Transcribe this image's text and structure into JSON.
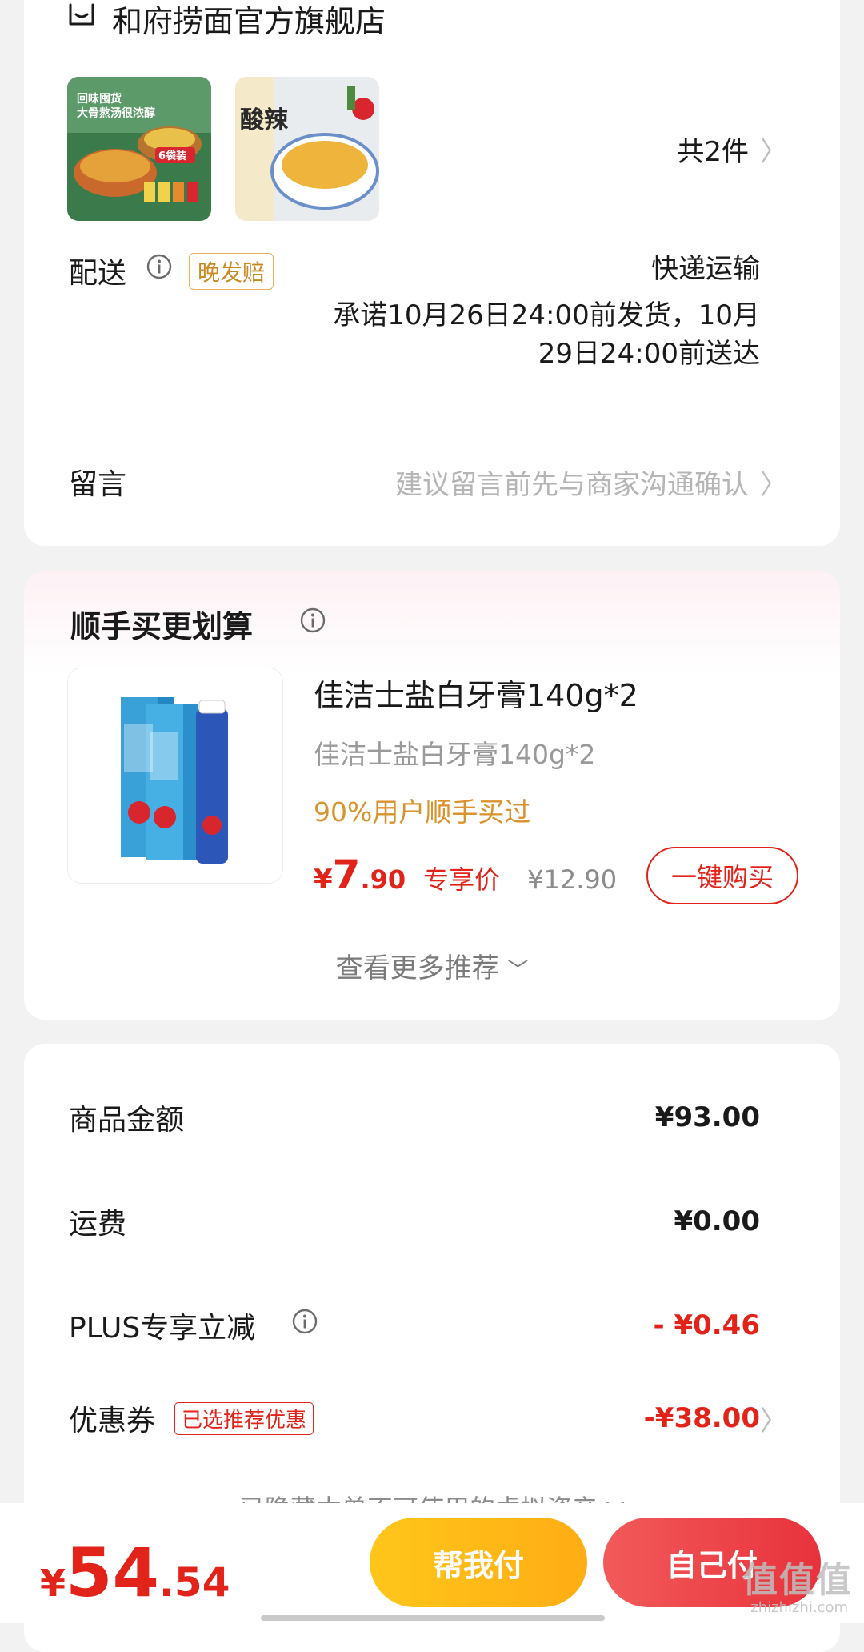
{
  "store": {
    "name": "和府捞面官方旗舰店",
    "thumb1_text_line1": "回味囤货",
    "thumb1_text_line2": "大骨熬汤很浓醇",
    "thumb1_badge": "6袋装",
    "thumb2_text": "酸辣",
    "item_count": "共2件",
    "delivery_label": "配送",
    "late_tag": "晚发赔",
    "shipping_method": "快递运输",
    "shipping_promise_line1": "承诺10月26日24:00前发货，10月",
    "shipping_promise_line2": "29日24:00前送达",
    "note_label": "留言",
    "note_placeholder": "建议留言前先与商家沟通确认"
  },
  "bundle": {
    "title": "顺手买更划算",
    "product_name": "佳洁士盐白牙膏140g*2",
    "product_spec": "佳洁士盐白牙膏140g*2",
    "social_proof": "90%用户顺手买过",
    "price_currency": "¥",
    "price_int": "7",
    "price_dec": ".90",
    "price_label": "专享价",
    "original_price": "¥12.90",
    "buy_button": "一键购买",
    "more_recs": "查看更多推荐"
  },
  "summary": {
    "goods_label": "商品金额",
    "goods_value": "¥93.00",
    "shipping_label": "运费",
    "shipping_value": "¥0.00",
    "plus_label": "PLUS专享立减",
    "plus_value": "- ¥0.46",
    "coupon_label": "优惠券",
    "coupon_tag": "已选推荐优惠",
    "coupon_value": "-¥38.00",
    "hidden_assets_note": "已隐藏本单不可使用的虚拟资产"
  },
  "footer": {
    "total_currency": "¥",
    "total_int": "54",
    "total_dec": ".54",
    "help_pay": "帮我付",
    "self_pay": "自己付",
    "watermark": "值值值",
    "watermark_sub": "zhizhizhi.com"
  },
  "colors": {
    "accent_red": "#e2231a",
    "tag_gold": "#c9891f",
    "help_yellow": "#ffb814"
  }
}
